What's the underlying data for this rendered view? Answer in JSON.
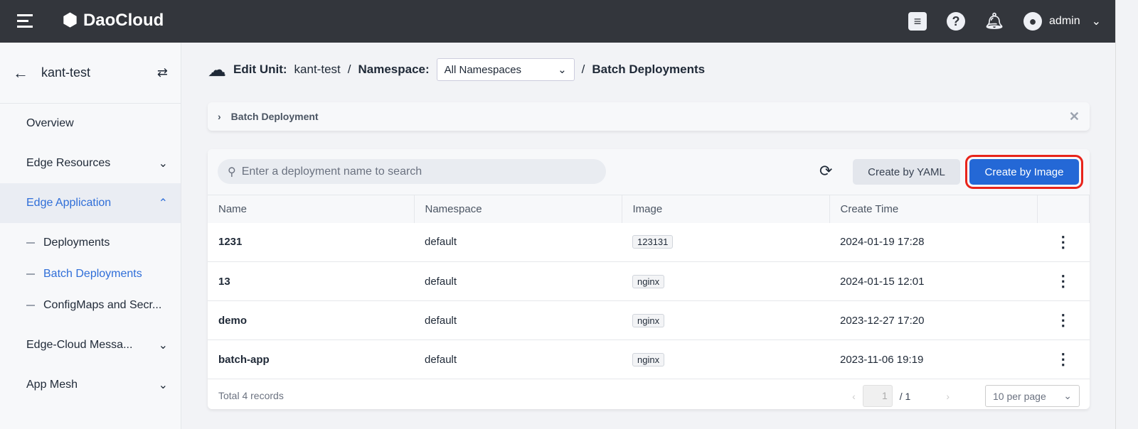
{
  "header": {
    "brand": "DaoCloud",
    "user": "admin"
  },
  "sidebar": {
    "unit": "kant-test",
    "items": [
      {
        "label": "Overview"
      },
      {
        "label": "Edge Resources"
      },
      {
        "label": "Edge Application"
      }
    ],
    "subitems": [
      {
        "label": "Deployments"
      },
      {
        "label": "Batch Deployments"
      },
      {
        "label": "ConfigMaps and Secr..."
      }
    ],
    "items2": [
      {
        "label": "Edge-Cloud Messa..."
      },
      {
        "label": "App Mesh"
      }
    ]
  },
  "breadcrumb": {
    "edit_unit_label": "Edit Unit:",
    "unit": "kant-test",
    "namespace_label": "Namespace:",
    "namespace_value": "All Namespaces",
    "page": "Batch Deployments"
  },
  "alert": {
    "title": "Batch Deployment"
  },
  "toolbar": {
    "search_placeholder": "Enter a deployment name to search",
    "yaml": "Create by YAML",
    "image": "Create by Image"
  },
  "table": {
    "columns": [
      "Name",
      "Namespace",
      "Image",
      "Create Time"
    ],
    "rows": [
      {
        "name": "1231",
        "namespace": "default",
        "image": "123131",
        "time": "2024-01-19 17:28"
      },
      {
        "name": "13",
        "namespace": "default",
        "image": "nginx",
        "time": "2024-01-15 12:01"
      },
      {
        "name": "demo",
        "namespace": "default",
        "image": "nginx",
        "time": "2023-12-27 17:20"
      },
      {
        "name": "batch-app",
        "namespace": "default",
        "image": "nginx",
        "time": "2023-11-06 19:19"
      }
    ]
  },
  "footer": {
    "total": "Total 4 records",
    "page": "1",
    "pages": "/ 1",
    "per_page": "10 per page"
  }
}
